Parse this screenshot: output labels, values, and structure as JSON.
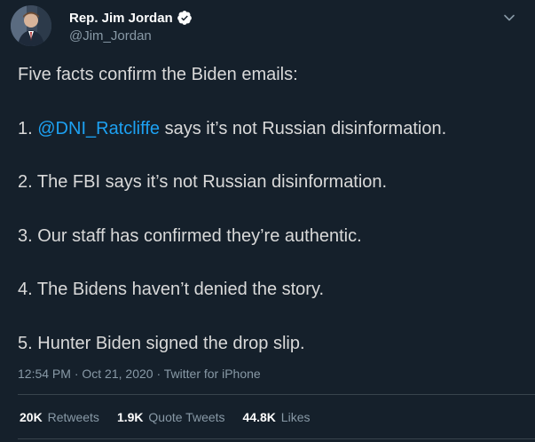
{
  "author": {
    "display_name": "Rep. Jim Jordan",
    "handle": "@Jim_Jordan",
    "verified": true
  },
  "tweet": {
    "intro": "Five facts confirm the Biden emails:",
    "points": [
      {
        "prefix": "1. ",
        "mention": "@DNI_Ratcliffe",
        "text": " says it’s not Russian disinformation."
      },
      {
        "prefix": "2. ",
        "mention": "",
        "text": "The FBI says it’s not Russian disinformation."
      },
      {
        "prefix": "3. ",
        "mention": "",
        "text": "Our staff has confirmed they’re authentic."
      },
      {
        "prefix": "4. ",
        "mention": "",
        "text": "The Bidens haven’t denied the story."
      },
      {
        "prefix": "5. ",
        "mention": "",
        "text": "Hunter Biden signed the drop slip."
      }
    ],
    "time": "12:54 PM",
    "date": "Oct 21, 2020",
    "source": "Twitter for iPhone",
    "separator": " · "
  },
  "stats": {
    "retweets_count": "20K",
    "retweets_label": "Retweets",
    "quotes_count": "1.9K",
    "quotes_label": "Quote Tweets",
    "likes_count": "44.8K",
    "likes_label": "Likes"
  },
  "colors": {
    "background": "#15202b",
    "mention": "#1da1f2",
    "verified_badge": "#ffffff",
    "muted": "#8899a6"
  },
  "icons": {
    "verified": "verified-badge-icon",
    "caret": "chevron-down-icon"
  }
}
